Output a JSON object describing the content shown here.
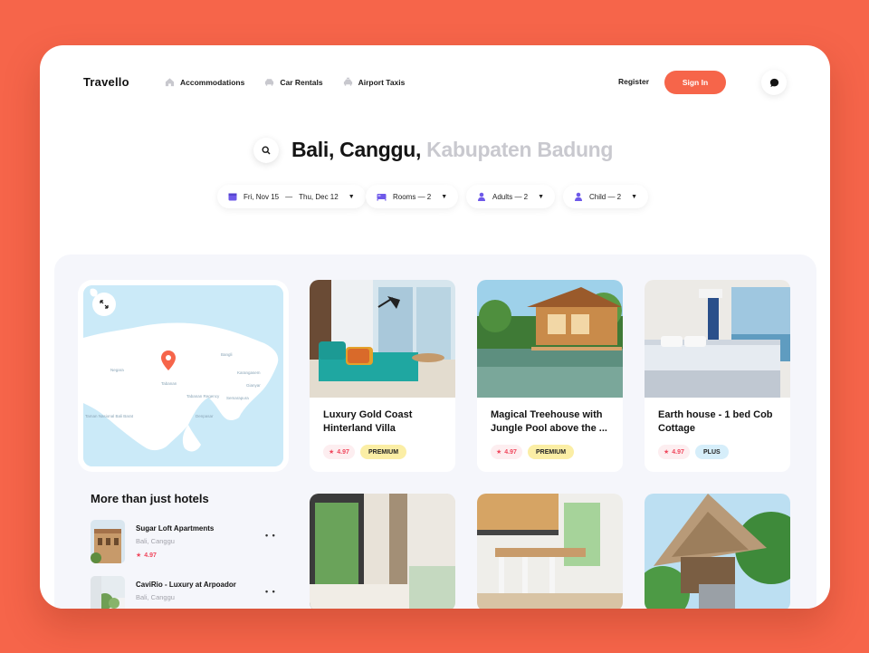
{
  "brand": {
    "logo": "Travello",
    "accent": "#f6654a"
  },
  "nav": {
    "items": [
      {
        "label": "Accommodations",
        "icon": "home-icon"
      },
      {
        "label": "Car Rentals",
        "icon": "car-icon"
      },
      {
        "label": "Airport Taxis",
        "icon": "taxi-icon"
      }
    ],
    "register": "Register",
    "signin": "Sign In"
  },
  "search": {
    "primary": "Bali, Canggu,",
    "secondary": "Kabupaten Badung"
  },
  "filters": {
    "dates": {
      "from": "Fri, Nov 15",
      "sep": "—",
      "to": "Thu, Dec 12"
    },
    "rooms": "Rooms — 2",
    "adults": "Adults — 2",
    "child": "Child — 2"
  },
  "map": {
    "labels": [
      "Negara",
      "Tabanan Regency",
      "Semarapura",
      "Denpasar",
      "Tabanan",
      "Karangasem",
      "Bangli",
      "Gianyar",
      "Taman Nasional Bali Barat"
    ],
    "pin": "location-pin-icon"
  },
  "sidebar": {
    "title": "More than just hotels",
    "items": [
      {
        "name": "Sugar Loft Apartments",
        "location": "Bali, Canggu",
        "rating": "4.97"
      },
      {
        "name": "CaviRio - Luxury at Arpoador",
        "location": "Bali, Canggu",
        "rating": "4.97"
      }
    ]
  },
  "hotels": [
    {
      "title": "Luxury Gold Coast Hinterland Villa",
      "rating": "4.97",
      "tag": "PREMIUM"
    },
    {
      "title": "Magical Treehouse with Jungle Pool above the ...",
      "rating": "4.97",
      "tag": "PREMIUM"
    },
    {
      "title": "Earth house - 1 bed Cob Cottage",
      "rating": "4.97",
      "tag": "PLUS"
    }
  ]
}
